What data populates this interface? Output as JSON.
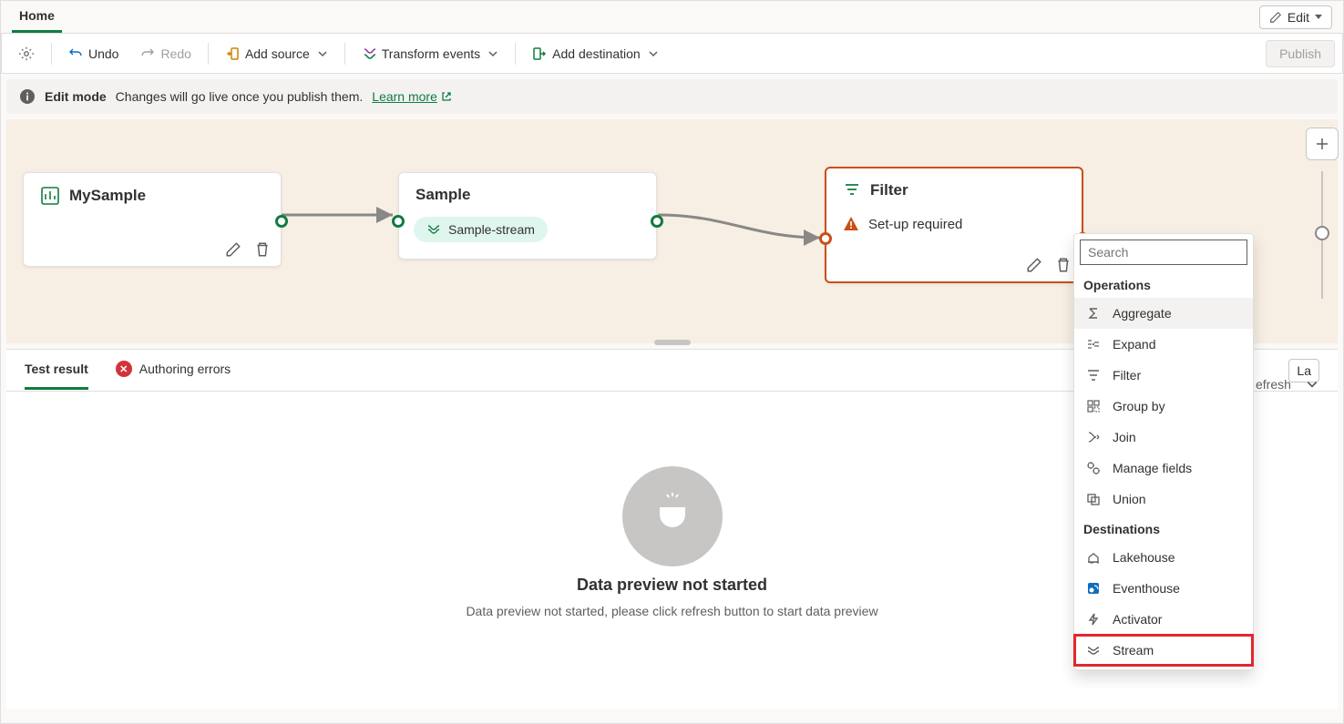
{
  "ribbon": {
    "tab_home": "Home",
    "edit_label": "Edit"
  },
  "toolbar": {
    "undo": "Undo",
    "redo": "Redo",
    "add_source": "Add source",
    "transform_events": "Transform events",
    "add_destination": "Add destination",
    "publish": "Publish"
  },
  "infobar": {
    "title": "Edit mode",
    "text": "Changes will go live once you publish them.",
    "learn_more": "Learn more"
  },
  "nodes": {
    "source": {
      "title": "MySample"
    },
    "sample": {
      "title": "Sample",
      "chip": "Sample-stream"
    },
    "filter": {
      "title": "Filter",
      "status": "Set-up required"
    }
  },
  "bottom": {
    "tab_test_result": "Test result",
    "tab_authoring_errors": "Authoring errors",
    "last_prefix": "La",
    "refresh_suffix": "efresh",
    "empty_title": "Data preview not started",
    "empty_text": "Data preview not started, please click refresh button to start data preview"
  },
  "dropdown": {
    "search_placeholder": "Search",
    "operations_header": "Operations",
    "destinations_header": "Destinations",
    "op_aggregate": "Aggregate",
    "op_expand": "Expand",
    "op_filter": "Filter",
    "op_groupby": "Group by",
    "op_join": "Join",
    "op_managefields": "Manage fields",
    "op_union": "Union",
    "dest_lakehouse": "Lakehouse",
    "dest_eventhouse": "Eventhouse",
    "dest_activator": "Activator",
    "dest_stream": "Stream"
  }
}
